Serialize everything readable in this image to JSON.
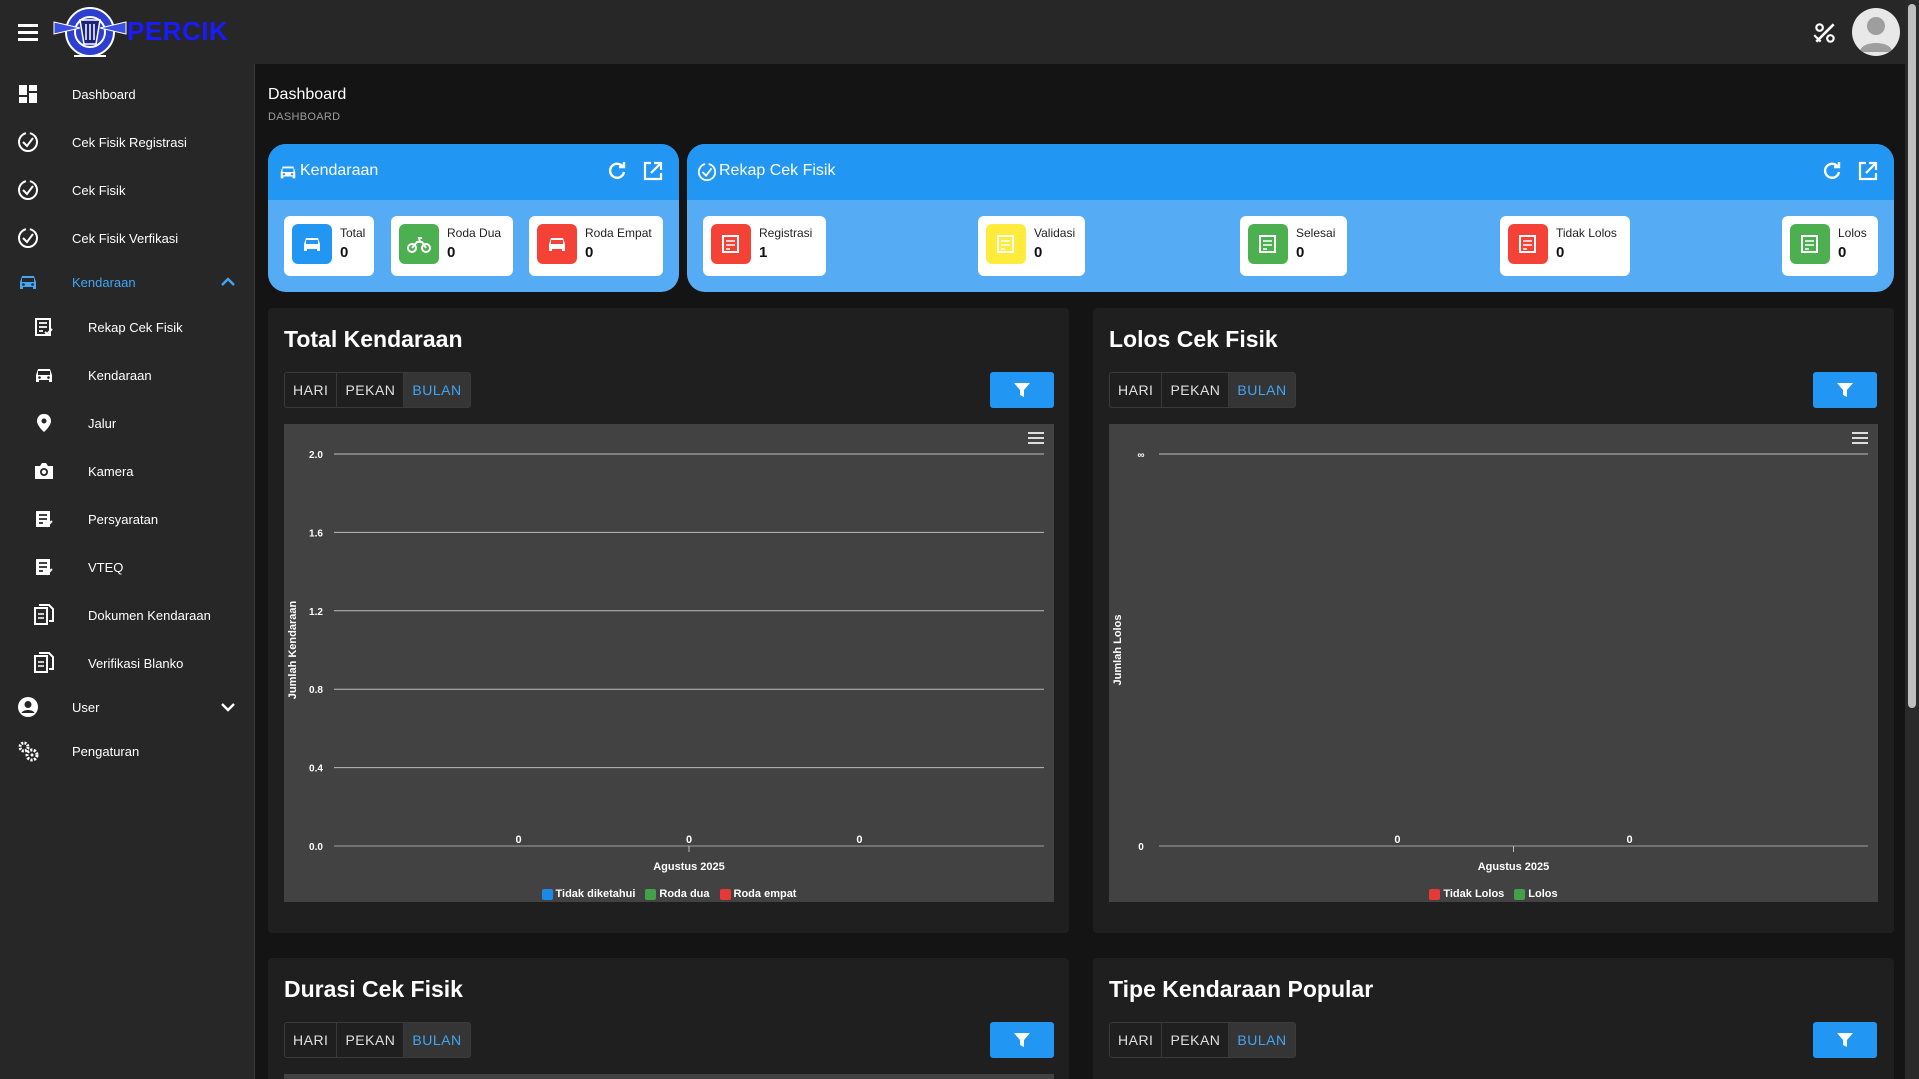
{
  "header": {
    "brand": "PERCIK"
  },
  "sidebar": {
    "items": [
      {
        "label": "Dashboard",
        "icon": "dashboard-icon"
      },
      {
        "label": "Cek Fisik Registrasi",
        "icon": "check-circle-icon"
      },
      {
        "label": "Cek Fisik",
        "icon": "check-circle-icon"
      },
      {
        "label": "Cek Fisik Verfikasi",
        "icon": "check-circle-icon"
      },
      {
        "label": "Kendaraan",
        "icon": "car-icon",
        "expanded": true
      },
      {
        "label": "Rekap Cek Fisik",
        "icon": "list-check-icon"
      },
      {
        "label": "Kendaraan",
        "icon": "car-icon"
      },
      {
        "label": "Jalur",
        "icon": "location-pin-icon"
      },
      {
        "label": "Kamera",
        "icon": "camera-icon"
      },
      {
        "label": "Persyaratan",
        "icon": "list-check-icon"
      },
      {
        "label": "VTEQ",
        "icon": "list-check-icon"
      },
      {
        "label": "Dokumen Kendaraan",
        "icon": "document-icon"
      },
      {
        "label": "Verifikasi Blanko",
        "icon": "document-icon"
      },
      {
        "label": "User",
        "icon": "account-icon"
      },
      {
        "label": "Pengaturan",
        "icon": "gears-icon"
      }
    ]
  },
  "page": {
    "title": "Dashboard",
    "breadcrumb": "DASHBOARD"
  },
  "kendaraan_card": {
    "title": "Kendaraan",
    "stats": [
      {
        "label": "Total",
        "value": "0",
        "color": "#2196f3"
      },
      {
        "label": "Roda Dua",
        "value": "0",
        "color": "#4caf50"
      },
      {
        "label": "Roda Empat",
        "value": "0",
        "color": "#f44336"
      }
    ]
  },
  "rekap_card": {
    "title": "Rekap Cek Fisik",
    "stats": [
      {
        "label": "Registrasi",
        "value": "1",
        "color": "#f44336"
      },
      {
        "label": "Validasi",
        "value": "0",
        "color": "#ffeb3b"
      },
      {
        "label": "Selesai",
        "value": "0",
        "color": "#4caf50"
      },
      {
        "label": "Tidak Lolos",
        "value": "0",
        "color": "#f44336"
      },
      {
        "label": "Lolos",
        "value": "0",
        "color": "#4caf50"
      }
    ]
  },
  "period_tabs": [
    "HARI",
    "PEKAN",
    "BULAN"
  ],
  "panels": {
    "total_kendaraan": {
      "title": "Total Kendaraan"
    },
    "lolos_cek_fisik": {
      "title": "Lolos Cek Fisik"
    },
    "durasi_cek_fisik": {
      "title": "Durasi Cek Fisik"
    },
    "tipe_kendaraan": {
      "title": "Tipe Kendaraan Popular"
    }
  },
  "chart_data": [
    {
      "type": "bar",
      "title": "",
      "xlabel": "",
      "ylabel": "Jumlah Kendaraan",
      "categories": [
        "Agustus 2025"
      ],
      "ylim": [
        0,
        2.0
      ],
      "yticks": [
        "0.0",
        "0.4",
        "0.8",
        "1.2",
        "1.6",
        "2.0"
      ],
      "series": [
        {
          "name": "Tidak diketahui",
          "values": [
            0
          ],
          "color": "#1e88e5"
        },
        {
          "name": "Roda dua",
          "values": [
            0
          ],
          "color": "#43a047"
        },
        {
          "name": "Roda empat",
          "values": [
            0
          ],
          "color": "#e53935"
        }
      ],
      "legend": "bottom",
      "grid": true
    },
    {
      "type": "bar",
      "title": "",
      "xlabel": "",
      "ylabel": "Jumlah Lolos",
      "categories": [
        "Agustus 2025"
      ],
      "yticks": [
        "0",
        "∞"
      ],
      "series": [
        {
          "name": "Tidak Lolos",
          "values": [
            0
          ],
          "color": "#e53935"
        },
        {
          "name": "Lolos",
          "values": [
            0
          ],
          "color": "#43a047"
        }
      ],
      "legend": "bottom",
      "grid": true
    }
  ]
}
